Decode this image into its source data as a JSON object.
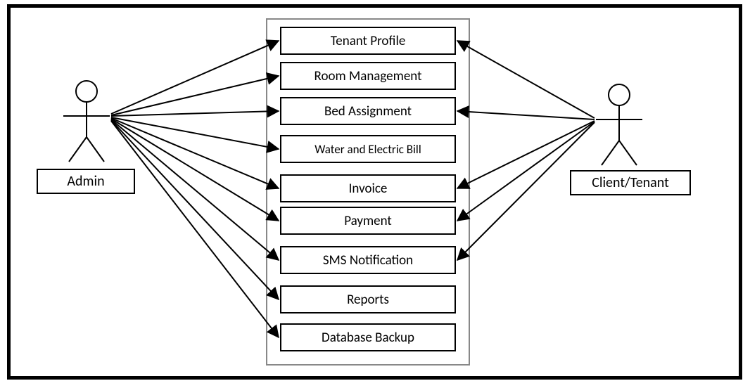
{
  "actors": {
    "left": {
      "label": "Admin"
    },
    "right": {
      "label": "Client/Tenant"
    }
  },
  "usecases": [
    {
      "label": "Tenant Profile"
    },
    {
      "label": "Room Management"
    },
    {
      "label": "Bed Assignment"
    },
    {
      "label": "Water and Electric Bill"
    },
    {
      "label": "Invoice"
    },
    {
      "label": "Payment"
    },
    {
      "label": "SMS Notification"
    },
    {
      "label": "Reports"
    },
    {
      "label": "Database Backup"
    }
  ],
  "connections": {
    "admin": [
      0,
      1,
      2,
      3,
      4,
      5,
      6,
      7,
      8
    ],
    "client": [
      0,
      2,
      4,
      5,
      6
    ]
  }
}
